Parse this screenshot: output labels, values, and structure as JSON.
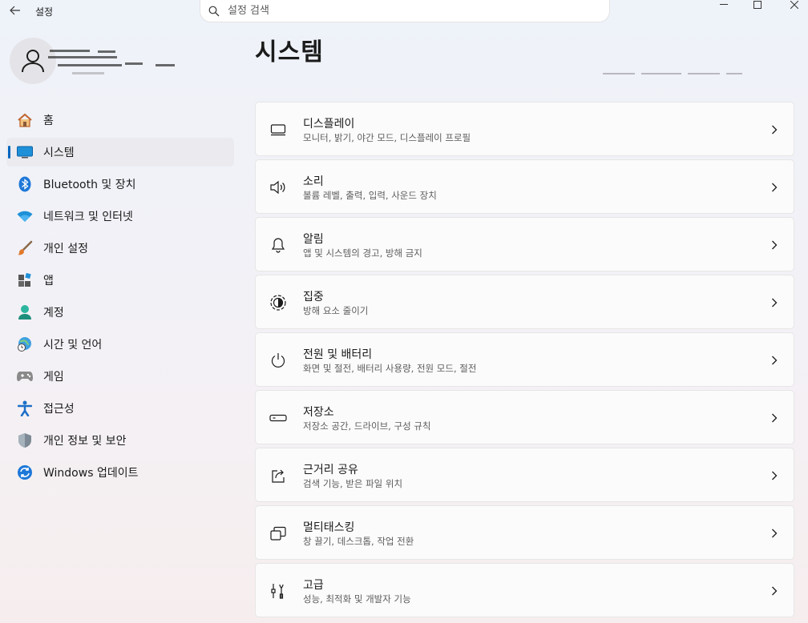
{
  "window": {
    "title": "설정"
  },
  "search": {
    "placeholder": "설정 검색"
  },
  "page": {
    "title": "시스템"
  },
  "nav": {
    "items": [
      {
        "label": "홈",
        "icon": "home-icon"
      },
      {
        "label": "시스템",
        "icon": "system-icon",
        "selected": true
      },
      {
        "label": "Bluetooth 및 장치",
        "icon": "bluetooth-icon"
      },
      {
        "label": "네트워크 및 인터넷",
        "icon": "wifi-icon"
      },
      {
        "label": "개인 설정",
        "icon": "brush-icon"
      },
      {
        "label": "앱",
        "icon": "apps-icon"
      },
      {
        "label": "계정",
        "icon": "account-icon"
      },
      {
        "label": "시간 및 언어",
        "icon": "globe-clock-icon"
      },
      {
        "label": "게임",
        "icon": "gamepad-icon"
      },
      {
        "label": "접근성",
        "icon": "accessibility-icon"
      },
      {
        "label": "개인 정보 및 보안",
        "icon": "shield-icon"
      },
      {
        "label": "Windows 업데이트",
        "icon": "update-icon"
      }
    ]
  },
  "cards": [
    {
      "title": "디스플레이",
      "subtitle": "모니터, 밝기, 야간 모드, 디스플레이 프로필",
      "icon": "display-icon"
    },
    {
      "title": "소리",
      "subtitle": "볼륨 레벨, 출력, 입력, 사운드 장치",
      "icon": "speaker-icon"
    },
    {
      "title": "알림",
      "subtitle": "앱 및 시스템의 경고, 방해 금지",
      "icon": "bell-icon"
    },
    {
      "title": "집중",
      "subtitle": "방해 요소 줄이기",
      "icon": "focus-icon"
    },
    {
      "title": "전원 및 배터리",
      "subtitle": "화면 및 절전, 배터리 사용량, 전원 모드, 절전",
      "icon": "power-icon"
    },
    {
      "title": "저장소",
      "subtitle": "저장소 공간, 드라이브, 구성 규칙",
      "icon": "storage-icon"
    },
    {
      "title": "근거리 공유",
      "subtitle": "검색 기능, 받은 파일 위치",
      "icon": "share-icon"
    },
    {
      "title": "멀티태스킹",
      "subtitle": "창 끌기, 데스크톱, 작업 전환",
      "icon": "multitask-icon"
    },
    {
      "title": "고급",
      "subtitle": "성능, 최적화 및 개발자 기능",
      "icon": "advanced-icon"
    }
  ],
  "colors": {
    "accent": "#0067c0"
  }
}
